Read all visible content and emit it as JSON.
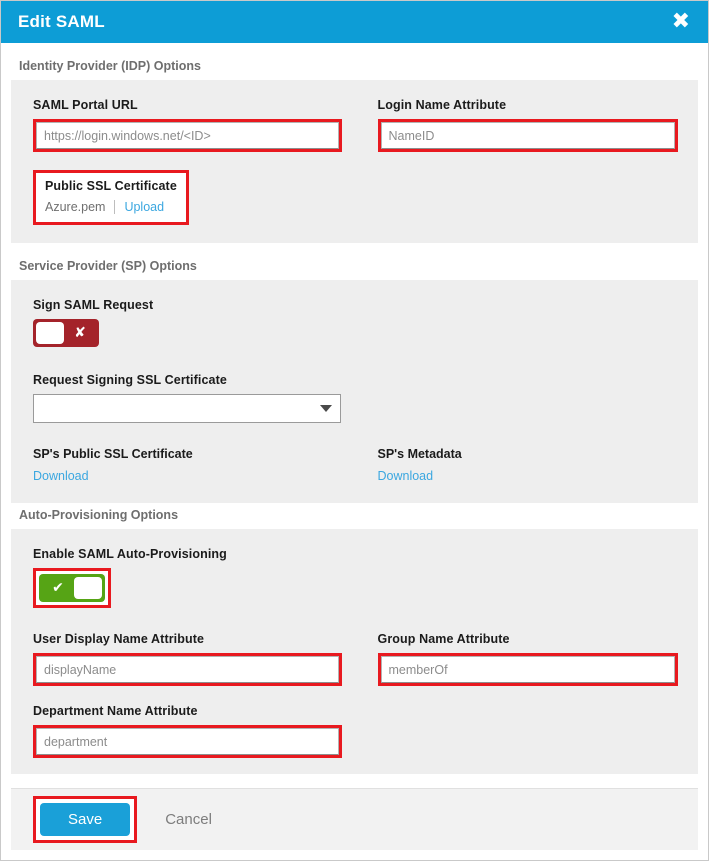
{
  "dialog": {
    "title": "Edit SAML",
    "close_icon": "close-icon"
  },
  "sections": {
    "idp": {
      "heading": "Identity Provider (IDP) Options",
      "portal_url": {
        "label": "SAML Portal URL",
        "value": "",
        "placeholder": "https://login.windows.net/<ID>"
      },
      "login_name_attribute": {
        "label": "Login Name Attribute",
        "value": "",
        "placeholder": "NameID"
      },
      "public_ssl_certificate": {
        "label": "Public SSL Certificate",
        "file_name": "Azure.pem",
        "upload_label": "Upload"
      }
    },
    "sp": {
      "heading": "Service Provider (SP) Options",
      "sign_saml_request": {
        "label": "Sign SAML Request",
        "state": "off",
        "glyph": "✘"
      },
      "request_signing_certificate": {
        "label": "Request Signing SSL Certificate",
        "selected": ""
      },
      "sp_public_ssl_certificate": {
        "label": "SP's Public SSL Certificate",
        "download_label": "Download"
      },
      "sp_metadata": {
        "label": "SP's Metadata",
        "download_label": "Download"
      }
    },
    "auto_provisioning": {
      "heading": "Auto-Provisioning Options",
      "enable_toggle": {
        "label": "Enable SAML Auto-Provisioning",
        "state": "on",
        "glyph": "✔"
      },
      "user_display_name": {
        "label": "User Display Name Attribute",
        "value": "",
        "placeholder": "displayName"
      },
      "group_name": {
        "label": "Group Name Attribute",
        "value": "",
        "placeholder": "memberOf"
      },
      "department_name": {
        "label": "Department Name Attribute",
        "value": "",
        "placeholder": "department"
      }
    }
  },
  "footer": {
    "save_label": "Save",
    "cancel_label": "Cancel"
  },
  "colors": {
    "header_blue": "#0d9dd6",
    "accent_blue": "#1aa0d8",
    "link_blue": "#3ba7e0",
    "toggle_off_red": "#a4232a",
    "toggle_on_green": "#56a415",
    "annotation_red": "#e8191f",
    "panel_gray": "#eeeeee"
  }
}
